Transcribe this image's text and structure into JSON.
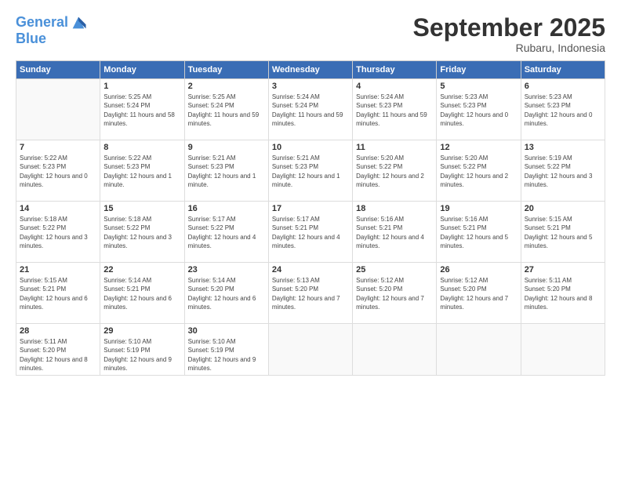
{
  "header": {
    "logo_line1": "General",
    "logo_line2": "Blue",
    "month_title": "September 2025",
    "location": "Rubaru, Indonesia"
  },
  "weekdays": [
    "Sunday",
    "Monday",
    "Tuesday",
    "Wednesday",
    "Thursday",
    "Friday",
    "Saturday"
  ],
  "weeks": [
    [
      {
        "day": "",
        "empty": true
      },
      {
        "day": "1",
        "sunrise": "Sunrise: 5:25 AM",
        "sunset": "Sunset: 5:24 PM",
        "daylight": "Daylight: 11 hours and 58 minutes."
      },
      {
        "day": "2",
        "sunrise": "Sunrise: 5:25 AM",
        "sunset": "Sunset: 5:24 PM",
        "daylight": "Daylight: 11 hours and 59 minutes."
      },
      {
        "day": "3",
        "sunrise": "Sunrise: 5:24 AM",
        "sunset": "Sunset: 5:24 PM",
        "daylight": "Daylight: 11 hours and 59 minutes."
      },
      {
        "day": "4",
        "sunrise": "Sunrise: 5:24 AM",
        "sunset": "Sunset: 5:23 PM",
        "daylight": "Daylight: 11 hours and 59 minutes."
      },
      {
        "day": "5",
        "sunrise": "Sunrise: 5:23 AM",
        "sunset": "Sunset: 5:23 PM",
        "daylight": "Daylight: 12 hours and 0 minutes."
      },
      {
        "day": "6",
        "sunrise": "Sunrise: 5:23 AM",
        "sunset": "Sunset: 5:23 PM",
        "daylight": "Daylight: 12 hours and 0 minutes."
      }
    ],
    [
      {
        "day": "7",
        "sunrise": "Sunrise: 5:22 AM",
        "sunset": "Sunset: 5:23 PM",
        "daylight": "Daylight: 12 hours and 0 minutes."
      },
      {
        "day": "8",
        "sunrise": "Sunrise: 5:22 AM",
        "sunset": "Sunset: 5:23 PM",
        "daylight": "Daylight: 12 hours and 1 minute."
      },
      {
        "day": "9",
        "sunrise": "Sunrise: 5:21 AM",
        "sunset": "Sunset: 5:23 PM",
        "daylight": "Daylight: 12 hours and 1 minute."
      },
      {
        "day": "10",
        "sunrise": "Sunrise: 5:21 AM",
        "sunset": "Sunset: 5:23 PM",
        "daylight": "Daylight: 12 hours and 1 minute."
      },
      {
        "day": "11",
        "sunrise": "Sunrise: 5:20 AM",
        "sunset": "Sunset: 5:22 PM",
        "daylight": "Daylight: 12 hours and 2 minutes."
      },
      {
        "day": "12",
        "sunrise": "Sunrise: 5:20 AM",
        "sunset": "Sunset: 5:22 PM",
        "daylight": "Daylight: 12 hours and 2 minutes."
      },
      {
        "day": "13",
        "sunrise": "Sunrise: 5:19 AM",
        "sunset": "Sunset: 5:22 PM",
        "daylight": "Daylight: 12 hours and 3 minutes."
      }
    ],
    [
      {
        "day": "14",
        "sunrise": "Sunrise: 5:18 AM",
        "sunset": "Sunset: 5:22 PM",
        "daylight": "Daylight: 12 hours and 3 minutes."
      },
      {
        "day": "15",
        "sunrise": "Sunrise: 5:18 AM",
        "sunset": "Sunset: 5:22 PM",
        "daylight": "Daylight: 12 hours and 3 minutes."
      },
      {
        "day": "16",
        "sunrise": "Sunrise: 5:17 AM",
        "sunset": "Sunset: 5:22 PM",
        "daylight": "Daylight: 12 hours and 4 minutes."
      },
      {
        "day": "17",
        "sunrise": "Sunrise: 5:17 AM",
        "sunset": "Sunset: 5:21 PM",
        "daylight": "Daylight: 12 hours and 4 minutes."
      },
      {
        "day": "18",
        "sunrise": "Sunrise: 5:16 AM",
        "sunset": "Sunset: 5:21 PM",
        "daylight": "Daylight: 12 hours and 4 minutes."
      },
      {
        "day": "19",
        "sunrise": "Sunrise: 5:16 AM",
        "sunset": "Sunset: 5:21 PM",
        "daylight": "Daylight: 12 hours and 5 minutes."
      },
      {
        "day": "20",
        "sunrise": "Sunrise: 5:15 AM",
        "sunset": "Sunset: 5:21 PM",
        "daylight": "Daylight: 12 hours and 5 minutes."
      }
    ],
    [
      {
        "day": "21",
        "sunrise": "Sunrise: 5:15 AM",
        "sunset": "Sunset: 5:21 PM",
        "daylight": "Daylight: 12 hours and 6 minutes."
      },
      {
        "day": "22",
        "sunrise": "Sunrise: 5:14 AM",
        "sunset": "Sunset: 5:21 PM",
        "daylight": "Daylight: 12 hours and 6 minutes."
      },
      {
        "day": "23",
        "sunrise": "Sunrise: 5:14 AM",
        "sunset": "Sunset: 5:20 PM",
        "daylight": "Daylight: 12 hours and 6 minutes."
      },
      {
        "day": "24",
        "sunrise": "Sunrise: 5:13 AM",
        "sunset": "Sunset: 5:20 PM",
        "daylight": "Daylight: 12 hours and 7 minutes."
      },
      {
        "day": "25",
        "sunrise": "Sunrise: 5:12 AM",
        "sunset": "Sunset: 5:20 PM",
        "daylight": "Daylight: 12 hours and 7 minutes."
      },
      {
        "day": "26",
        "sunrise": "Sunrise: 5:12 AM",
        "sunset": "Sunset: 5:20 PM",
        "daylight": "Daylight: 12 hours and 7 minutes."
      },
      {
        "day": "27",
        "sunrise": "Sunrise: 5:11 AM",
        "sunset": "Sunset: 5:20 PM",
        "daylight": "Daylight: 12 hours and 8 minutes."
      }
    ],
    [
      {
        "day": "28",
        "sunrise": "Sunrise: 5:11 AM",
        "sunset": "Sunset: 5:20 PM",
        "daylight": "Daylight: 12 hours and 8 minutes."
      },
      {
        "day": "29",
        "sunrise": "Sunrise: 5:10 AM",
        "sunset": "Sunset: 5:19 PM",
        "daylight": "Daylight: 12 hours and 9 minutes."
      },
      {
        "day": "30",
        "sunrise": "Sunrise: 5:10 AM",
        "sunset": "Sunset: 5:19 PM",
        "daylight": "Daylight: 12 hours and 9 minutes."
      },
      {
        "day": "",
        "empty": true
      },
      {
        "day": "",
        "empty": true
      },
      {
        "day": "",
        "empty": true
      },
      {
        "day": "",
        "empty": true
      }
    ]
  ]
}
